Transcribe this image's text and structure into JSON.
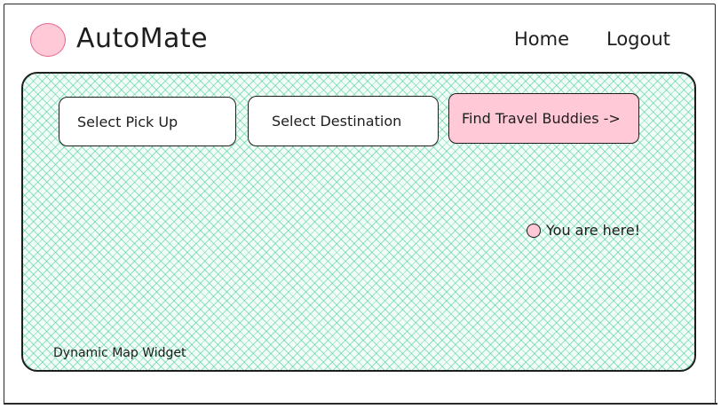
{
  "colors": {
    "accent_pink": "#ffc9d8",
    "map_hatch": "#40cc96",
    "stroke": "#1e1e1e"
  },
  "header": {
    "logo_icon": "circle-logo-icon",
    "brand": "AutoMate",
    "nav": {
      "home": "Home",
      "logout": "Logout"
    }
  },
  "map": {
    "controls": {
      "pickup": "Select Pick Up",
      "destination": "Select Destination",
      "find": "Find Travel Buddies ->"
    },
    "marker_icon": "location-dot-icon",
    "marker_label": "You are here!",
    "caption": "Dynamic Map Widget"
  }
}
